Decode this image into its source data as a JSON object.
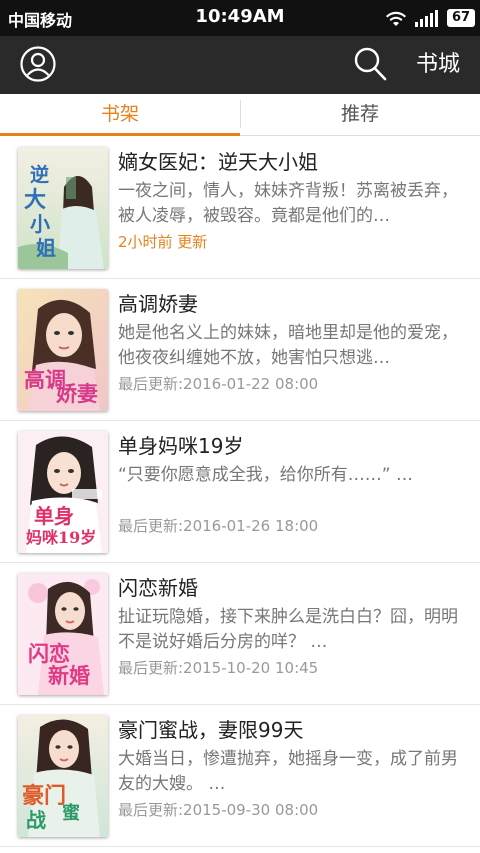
{
  "status_bar": {
    "carrier": "中国移动",
    "time": "10:49AM",
    "battery": "67"
  },
  "app_bar": {
    "profile_icon": "user-circle-icon",
    "search_icon": "search-icon",
    "store_label": "书城"
  },
  "tabs": [
    {
      "label": "书架",
      "active": true
    },
    {
      "label": "推荐",
      "active": false
    }
  ],
  "colors": {
    "accent": "#e8811c",
    "app_bar": "#2a2a2a",
    "status_bar": "#111111"
  },
  "books": [
    {
      "title": "嫡女医妃：逆天大小姐",
      "description": "一夜之间，情人，妹妹齐背叛！苏离被丢弃，被人凌辱，被毁容。竟都是他们的…",
      "updated": "2小时前 更新",
      "recent": true,
      "cover_text": "逆天大小姐"
    },
    {
      "title": "高调娇妻",
      "description": "她是他名义上的妹妹，暗地里却是他的爱宠，他夜夜纠缠她不放，她害怕只想逃…",
      "updated": "最后更新:2016-01-22 08:00",
      "recent": false,
      "cover_text": "高调娇妻"
    },
    {
      "title": "单身妈咪19岁",
      "description": "“只要你愿意成全我，给你所有……” …",
      "updated": "最后更新:2016-01-26 18:00",
      "recent": false,
      "cover_text": "单身妈咪19岁"
    },
    {
      "title": "闪恋新婚",
      "description": "扯证玩隐婚，接下来肿么是洗白白？囧，明明不是说好婚后分房的咩？ …",
      "updated": "最后更新:2015-10-20 10:45",
      "recent": false,
      "cover_text": "闪恋新婚"
    },
    {
      "title": "豪门蜜战，妻限99天",
      "description": "大婚当日，惨遭抛弃，她摇身一变，成了前男友的大嫂。 …",
      "updated": "最后更新:2015-09-30 08:00",
      "recent": false,
      "cover_text": "豪门蜜战"
    }
  ]
}
